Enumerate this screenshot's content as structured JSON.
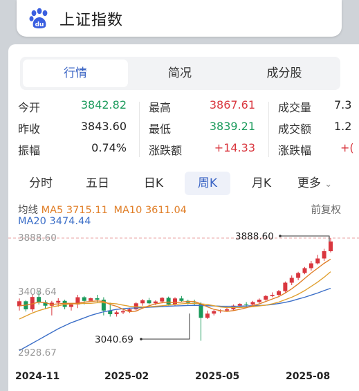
{
  "search": {
    "query": "上证指数"
  },
  "tabs": [
    "行情",
    "简况",
    "成分股"
  ],
  "stats": {
    "rows": [
      [
        {
          "label": "今开",
          "value": "3842.82",
          "color": "green"
        },
        {
          "label": "最高",
          "value": "3867.61",
          "color": "red"
        },
        {
          "label": "成交量",
          "value": "7.3",
          "color": "blk"
        }
      ],
      [
        {
          "label": "昨收",
          "value": "3843.60",
          "color": "blk"
        },
        {
          "label": "最低",
          "value": "3839.21",
          "color": "green"
        },
        {
          "label": "成交额",
          "value": "1.2",
          "color": "blk"
        }
      ],
      [
        {
          "label": "振幅",
          "value": "0.74%",
          "color": "blk"
        },
        {
          "label": "涨跌额",
          "value": "+14.33",
          "color": "red"
        },
        {
          "label": "涨跌幅",
          "value": "+(",
          "color": "red"
        }
      ]
    ]
  },
  "period_tabs": [
    "分时",
    "五日",
    "日K",
    "周K",
    "月K",
    "更多"
  ],
  "active_period": "周K",
  "ma": {
    "label": "均线",
    "ma5": "MA5 3715.11",
    "ma10": "MA10 3611.04",
    "ma20": "MA20 3474.44",
    "adjust": "前复权"
  },
  "colors": {
    "up": "#d9363e",
    "down": "#1a9a5b",
    "ma5": "#e07e27",
    "ma10": "#e0a030",
    "ma20": "#3c6fc8",
    "accent": "#3a64c4"
  },
  "chart_data": {
    "type": "candlestick",
    "y_axis_labels": [
      "3888.60",
      "3408.64",
      "2928.67"
    ],
    "x_axis_labels": [
      "2024-11",
      "2025-02",
      "2025-05",
      "2025-08"
    ],
    "annotations": [
      {
        "text": "3888.60",
        "type": "high"
      },
      {
        "text": "3040.69",
        "type": "low"
      }
    ],
    "ylim": [
      2928.67,
      3888.6
    ],
    "candles": [
      [
        3326,
        3390,
        3290,
        3367
      ],
      [
        3367,
        3376,
        3282,
        3300
      ],
      [
        3300,
        3420,
        3280,
        3402
      ],
      [
        3402,
        3450,
        3340,
        3360
      ],
      [
        3360,
        3374,
        3300,
        3330
      ],
      [
        3330,
        3370,
        3250,
        3355
      ],
      [
        3355,
        3392,
        3322,
        3370
      ],
      [
        3370,
        3380,
        3300,
        3320
      ],
      [
        3320,
        3350,
        3290,
        3340
      ],
      [
        3340,
        3420,
        3310,
        3400
      ],
      [
        3400,
        3410,
        3340,
        3370
      ],
      [
        3370,
        3398,
        3380,
        3392
      ],
      [
        3392,
        3420,
        3360,
        3380
      ],
      [
        3380,
        3400,
        3250,
        3290
      ],
      [
        3290,
        3355,
        3240,
        3260
      ],
      [
        3260,
        3290,
        3240,
        3275
      ],
      [
        3275,
        3300,
        3260,
        3285
      ],
      [
        3285,
        3310,
        3270,
        3300
      ],
      [
        3300,
        3360,
        3290,
        3350
      ],
      [
        3350,
        3385,
        3330,
        3375
      ],
      [
        3375,
        3395,
        3340,
        3350
      ],
      [
        3350,
        3375,
        3335,
        3365
      ],
      [
        3365,
        3400,
        3350,
        3395
      ],
      [
        3395,
        3405,
        3330,
        3340
      ],
      [
        3340,
        3400,
        3330,
        3390
      ],
      [
        3390,
        3410,
        3360,
        3370
      ],
      [
        3370,
        3380,
        3340,
        3355
      ],
      [
        3355,
        3380,
        3335,
        3345
      ],
      [
        3345,
        3360,
        3040.69,
        3230
      ],
      [
        3230,
        3290,
        3220,
        3265
      ],
      [
        3265,
        3295,
        3250,
        3286
      ],
      [
        3286,
        3300,
        3270,
        3290
      ],
      [
        3290,
        3320,
        3280,
        3300
      ],
      [
        3300,
        3340,
        3290,
        3330
      ],
      [
        3330,
        3350,
        3320,
        3345
      ],
      [
        3345,
        3360,
        3320,
        3340
      ],
      [
        3340,
        3370,
        3330,
        3360
      ],
      [
        3360,
        3390,
        3350,
        3380
      ],
      [
        3380,
        3420,
        3370,
        3410
      ],
      [
        3410,
        3440,
        3400,
        3420
      ],
      [
        3420,
        3460,
        3410,
        3450
      ],
      [
        3450,
        3530,
        3440,
        3520
      ],
      [
        3520,
        3580,
        3500,
        3560
      ],
      [
        3560,
        3610,
        3540,
        3600
      ],
      [
        3600,
        3650,
        3590,
        3640
      ],
      [
        3640,
        3700,
        3620,
        3680
      ],
      [
        3680,
        3750,
        3670,
        3720
      ],
      [
        3720,
        3800,
        3700,
        3780
      ],
      [
        3780,
        3888.6,
        3770,
        3860
      ]
    ],
    "ma5": [
      3330,
      3335,
      3345,
      3360,
      3355,
      3340,
      3345,
      3350,
      3350,
      3350,
      3360,
      3365,
      3370,
      3365,
      3340,
      3325,
      3300,
      3280,
      3285,
      3310,
      3330,
      3345,
      3355,
      3360,
      3355,
      3360,
      3365,
      3365,
      3345,
      3320,
      3300,
      3290,
      3283,
      3290,
      3300,
      3313,
      3330,
      3345,
      3365,
      3385,
      3405,
      3435,
      3470,
      3510,
      3555,
      3600,
      3640,
      3680,
      3715
    ],
    "ma10": [
      3220,
      3245,
      3270,
      3290,
      3305,
      3320,
      3330,
      3340,
      3345,
      3345,
      3350,
      3350,
      3355,
      3355,
      3350,
      3345,
      3335,
      3325,
      3320,
      3320,
      3322,
      3325,
      3330,
      3335,
      3340,
      3345,
      3350,
      3350,
      3345,
      3340,
      3330,
      3320,
      3315,
      3315,
      3315,
      3318,
      3322,
      3328,
      3335,
      3345,
      3360,
      3380,
      3400,
      3425,
      3455,
      3490,
      3525,
      3565,
      3611
    ],
    "ma20": [
      2960,
      2990,
      3020,
      3050,
      3080,
      3110,
      3140,
      3165,
      3190,
      3210,
      3230,
      3250,
      3265,
      3280,
      3290,
      3300,
      3305,
      3310,
      3312,
      3315,
      3318,
      3320,
      3322,
      3325,
      3328,
      3330,
      3332,
      3333,
      3332,
      3330,
      3328,
      3326,
      3325,
      3325,
      3326,
      3328,
      3330,
      3332,
      3335,
      3340,
      3348,
      3358,
      3370,
      3385,
      3400,
      3418,
      3435,
      3455,
      3474
    ]
  }
}
